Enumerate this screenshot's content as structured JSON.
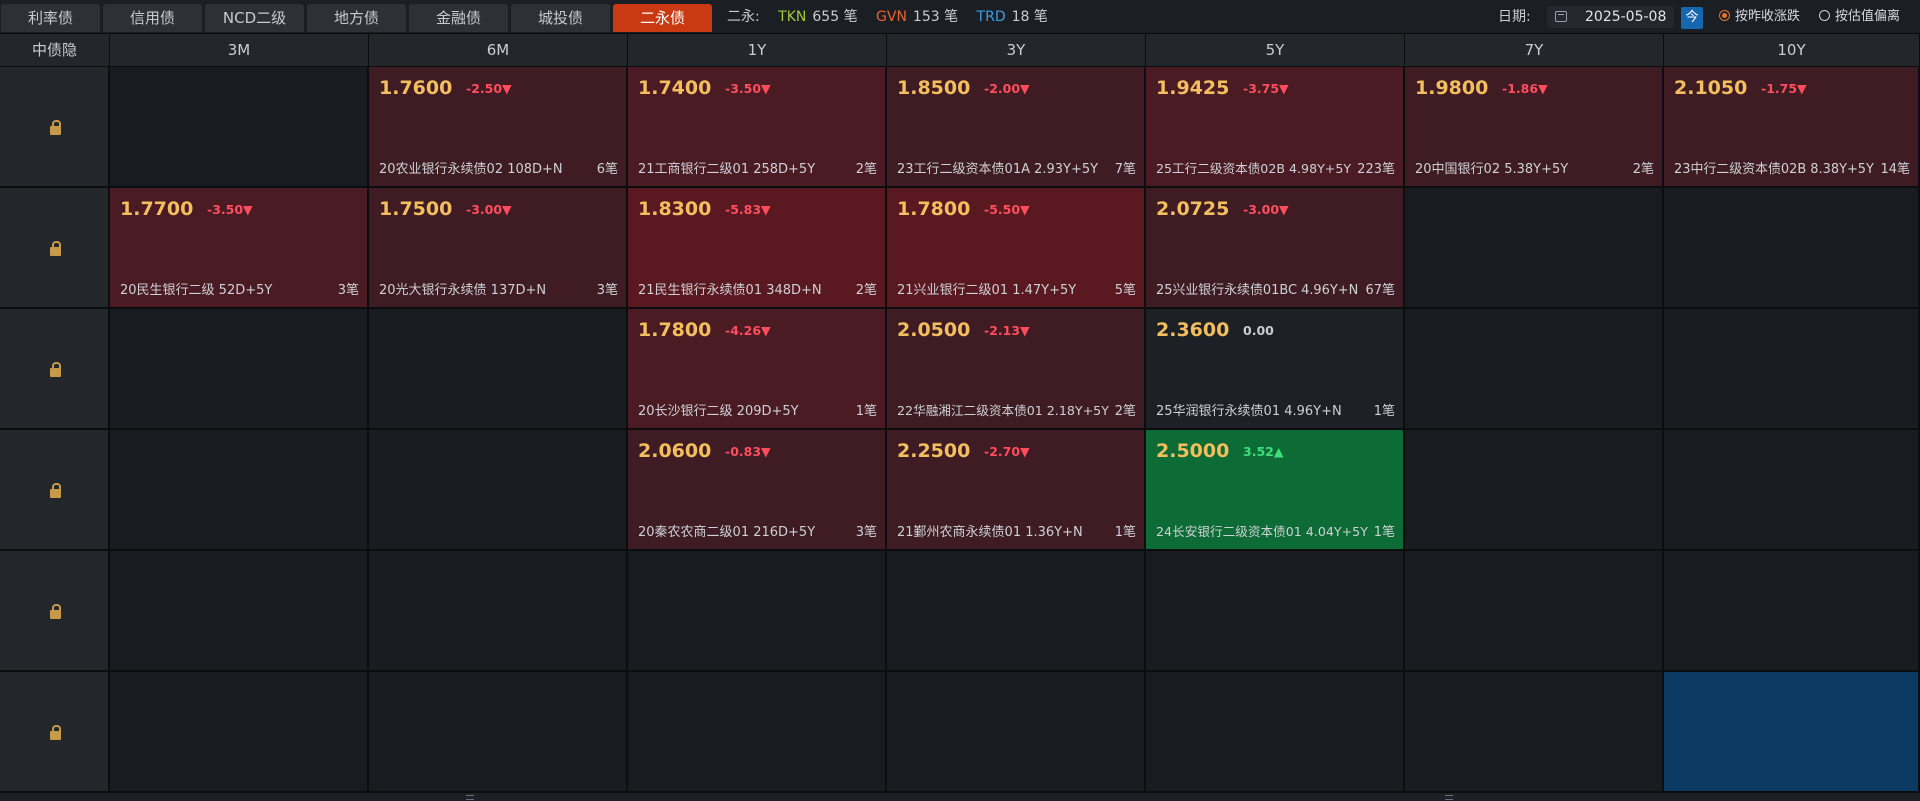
{
  "tabs": [
    {
      "label": "利率债",
      "active": false
    },
    {
      "label": "信用债",
      "active": false
    },
    {
      "label": "NCD二级",
      "active": false
    },
    {
      "label": "地方债",
      "active": false
    },
    {
      "label": "金融债",
      "active": false
    },
    {
      "label": "城投债",
      "active": false
    },
    {
      "label": "二永债",
      "active": true
    }
  ],
  "stats": {
    "label": "二永:",
    "tkn_key": "TKN",
    "tkn_val": "655 笔",
    "gvn_key": "GVN",
    "gvn_val": "153 笔",
    "trd_key": "TRD",
    "trd_val": "18 笔"
  },
  "date": {
    "label": "日期:",
    "value": "2025-05-08",
    "today": "今"
  },
  "radios": [
    {
      "label": "按昨收涨跌",
      "checked": true
    },
    {
      "label": "按估值偏离",
      "checked": false
    }
  ],
  "grid": {
    "row_header": "中债隐",
    "columns": [
      "3M",
      "6M",
      "1Y",
      "3Y",
      "5Y",
      "7Y",
      "10Y"
    ],
    "rows": [
      [
        null,
        {
          "price": "1.7600",
          "change": "-2.50▼",
          "bond": "20农业银行永续债02 108D+N",
          "count": "6笔",
          "tone": "red1"
        },
        {
          "price": "1.7400",
          "change": "-3.50▼",
          "bond": "21工商银行二级01 258D+5Y",
          "count": "2笔",
          "tone": "red2"
        },
        {
          "price": "1.8500",
          "change": "-2.00▼",
          "bond": "23工行二级资本债01A 2.93Y+5Y",
          "count": "7笔",
          "tone": "red1"
        },
        {
          "price": "1.9425",
          "change": "-3.75▼",
          "bond": "25工行二级资本债02B 4.98Y+5Y",
          "count": "223笔",
          "tone": "red2"
        },
        {
          "price": "1.9800",
          "change": "-1.86▼",
          "bond": "20中国银行02 5.38Y+5Y",
          "count": "2笔",
          "tone": "red1"
        },
        {
          "price": "2.1050",
          "change": "-1.75▼",
          "bond": "23中行二级资本债02B 8.38Y+5Y",
          "count": "14笔",
          "tone": "red1"
        }
      ],
      [
        {
          "price": "1.7700",
          "change": "-3.50▼",
          "bond": "20民生银行二级 52D+5Y",
          "count": "3笔",
          "tone": "red2"
        },
        {
          "price": "1.7500",
          "change": "-3.00▼",
          "bond": "20光大银行永续债 137D+N",
          "count": "3笔",
          "tone": "red1"
        },
        {
          "price": "1.8300",
          "change": "-5.83▼",
          "bond": "21民生银行永续债01 348D+N",
          "count": "2笔",
          "tone": "red3"
        },
        {
          "price": "1.7800",
          "change": "-5.50▼",
          "bond": "21兴业银行二级01 1.47Y+5Y",
          "count": "5笔",
          "tone": "red3"
        },
        {
          "price": "2.0725",
          "change": "-3.00▼",
          "bond": "25兴业银行永续债01BC 4.96Y+N",
          "count": "67笔",
          "tone": "red1"
        },
        null,
        null
      ],
      [
        null,
        null,
        {
          "price": "1.7800",
          "change": "-4.26▼",
          "bond": "20长沙银行二级 209D+5Y",
          "count": "1笔",
          "tone": "red2"
        },
        {
          "price": "2.0500",
          "change": "-2.13▼",
          "bond": "22华融湘江二级资本债01 2.18Y+5Y",
          "count": "2笔",
          "tone": "red1"
        },
        {
          "price": "2.3600",
          "change": "0.00",
          "bond": "25华润银行永续债01 4.96Y+N",
          "count": "1笔",
          "tone": "neutral"
        },
        null,
        null
      ],
      [
        null,
        null,
        {
          "price": "2.0600",
          "change": "-0.83▼",
          "bond": "20秦农农商二级01 216D+5Y",
          "count": "3笔",
          "tone": "red1"
        },
        {
          "price": "2.2500",
          "change": "-2.70▼",
          "bond": "21鄞州农商永续债01 1.36Y+N",
          "count": "1笔",
          "tone": "red1"
        },
        {
          "price": "2.5000",
          "change": "3.52▲",
          "bond": "24长安银行二级资本债01 4.04Y+5Y",
          "count": "1笔",
          "tone": "green"
        },
        null,
        null
      ],
      [
        null,
        null,
        null,
        null,
        null,
        null,
        null
      ],
      [
        null,
        null,
        null,
        null,
        null,
        null,
        {
          "tone": "blue"
        }
      ]
    ]
  },
  "icons": {
    "lock": "lock-icon",
    "calendar": "calendar-icon"
  },
  "colors": {
    "accent": "#c93a12",
    "price": "#f3bf5e",
    "down": "#ff4d5e",
    "up": "#3ee07a"
  }
}
